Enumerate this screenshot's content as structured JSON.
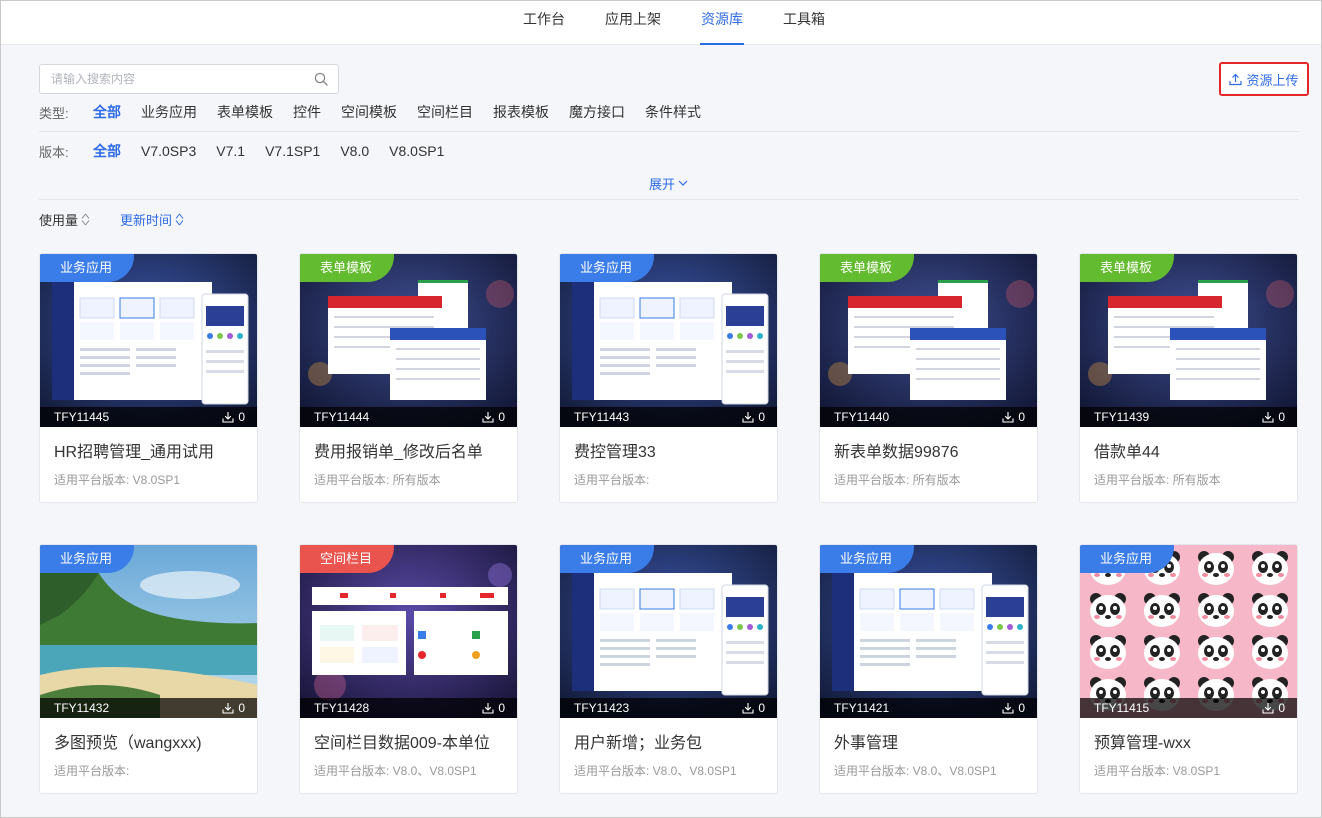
{
  "nav": {
    "tabs": [
      {
        "label": "工作台"
      },
      {
        "label": "应用上架"
      },
      {
        "label": "资源库"
      },
      {
        "label": "工具箱"
      }
    ]
  },
  "search": {
    "placeholder": "请输入搜索内容",
    "value": ""
  },
  "upload": {
    "label": "资源上传"
  },
  "filters": {
    "type": {
      "label": "类型:",
      "items": [
        "全部",
        "业务应用",
        "表单模板",
        "控件",
        "空间模板",
        "空间栏目",
        "报表模板",
        "魔方接口",
        "条件样式"
      ]
    },
    "version": {
      "label": "版本:",
      "items": [
        "全部",
        "V7.0SP3",
        "V7.1",
        "V7.1SP1",
        "V8.0",
        "V8.0SP1"
      ]
    },
    "expand_label": "展开"
  },
  "sort": {
    "usage": "使用量",
    "updated": "更新时间"
  },
  "colors": {
    "accent": "#2e6be6",
    "tag_business": "#3a7de8",
    "tag_form": "#63bb2f",
    "tag_column": "#e9544e",
    "highlight": "#e5262b"
  },
  "cards": [
    {
      "tag": "业务应用",
      "id": "TFY11445",
      "downloads": "0",
      "title": "HR招聘管理_通用试用",
      "version": "适用平台版本: V8.0SP1"
    },
    {
      "tag": "表单模板",
      "id": "TFY11444",
      "downloads": "0",
      "title": "费用报销单_修改后名单",
      "version": "适用平台版本: 所有版本"
    },
    {
      "tag": "业务应用",
      "id": "TFY11443",
      "downloads": "0",
      "title": "费控管理33",
      "version": "适用平台版本:"
    },
    {
      "tag": "表单模板",
      "id": "TFY11440",
      "downloads": "0",
      "title": "新表单数据99876",
      "version": "适用平台版本: 所有版本"
    },
    {
      "tag": "表单模板",
      "id": "TFY11439",
      "downloads": "0",
      "title": "借款单44",
      "version": "适用平台版本: 所有版本"
    },
    {
      "tag": "业务应用",
      "id": "TFY11432",
      "downloads": "0",
      "title": "多图预览（wangxxx)",
      "version": "适用平台版本:"
    },
    {
      "tag": "空间栏目",
      "id": "TFY11428",
      "downloads": "0",
      "title": "空间栏目数据009-本单位",
      "version": "适用平台版本: V8.0、V8.0SP1"
    },
    {
      "tag": "业务应用",
      "id": "TFY11423",
      "downloads": "0",
      "title": "用户新增；业务包",
      "version": "适用平台版本: V8.0、V8.0SP1"
    },
    {
      "tag": "业务应用",
      "id": "TFY11421",
      "downloads": "0",
      "title": "外事管理",
      "version": "适用平台版本: V8.0、V8.0SP1"
    },
    {
      "tag": "业务应用",
      "id": "TFY11415",
      "downloads": "0",
      "title": "预算管理-wxx",
      "version": "适用平台版本: V8.0SP1"
    }
  ]
}
